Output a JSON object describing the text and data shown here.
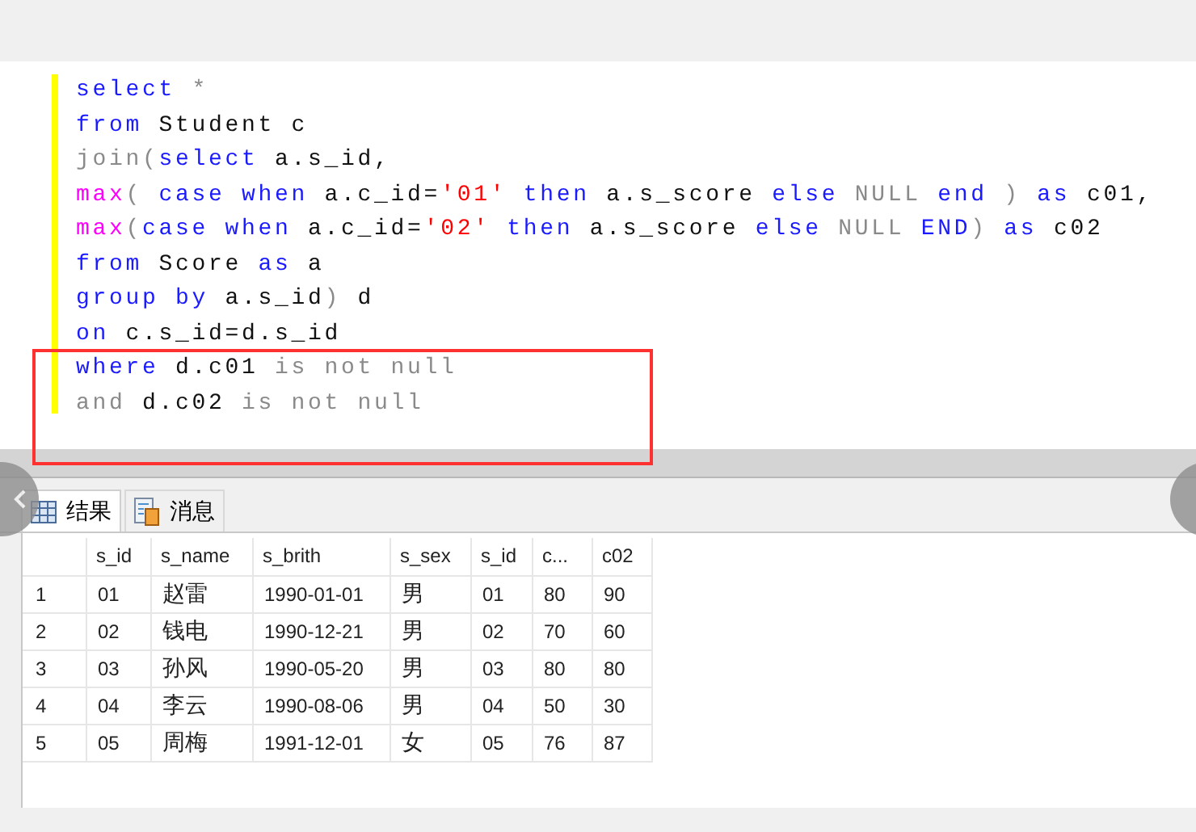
{
  "editor": {
    "lines": [
      [
        {
          "kind": "kw",
          "text": "select"
        },
        {
          "kind": "op",
          "text": " *"
        }
      ],
      [
        {
          "kind": "kw",
          "text": "from"
        },
        {
          "kind": "id",
          "text": " Student c"
        }
      ],
      [
        {
          "kind": "op",
          "text": "join("
        },
        {
          "kind": "kw",
          "text": "select"
        },
        {
          "kind": "id",
          "text": " a.s_id,"
        }
      ],
      [
        {
          "kind": "fn",
          "text": "max"
        },
        {
          "kind": "op",
          "text": "( "
        },
        {
          "kind": "kw",
          "text": "case when"
        },
        {
          "kind": "id",
          "text": " a.c_id="
        },
        {
          "kind": "str",
          "text": "'01'"
        },
        {
          "kind": "kw",
          "text": " then"
        },
        {
          "kind": "id",
          "text": " a.s_score "
        },
        {
          "kind": "kw",
          "text": "else"
        },
        {
          "kind": "op",
          "text": " NULL"
        },
        {
          "kind": "kw",
          "text": " end"
        },
        {
          "kind": "op",
          "text": " ) "
        },
        {
          "kind": "kw",
          "text": "as"
        },
        {
          "kind": "id",
          "text": " c01,"
        }
      ],
      [
        {
          "kind": "fn",
          "text": "max"
        },
        {
          "kind": "op",
          "text": "("
        },
        {
          "kind": "kw",
          "text": "case when"
        },
        {
          "kind": "id",
          "text": " a.c_id="
        },
        {
          "kind": "str",
          "text": "'02'"
        },
        {
          "kind": "kw",
          "text": " then"
        },
        {
          "kind": "id",
          "text": " a.s_score "
        },
        {
          "kind": "kw",
          "text": "else"
        },
        {
          "kind": "op",
          "text": " NULL"
        },
        {
          "kind": "kw",
          "text": " END"
        },
        {
          "kind": "op",
          "text": ")"
        },
        {
          "kind": "kw",
          "text": " as"
        },
        {
          "kind": "id",
          "text": " c02"
        }
      ],
      [
        {
          "kind": "kw",
          "text": "from"
        },
        {
          "kind": "id",
          "text": " Score "
        },
        {
          "kind": "kw",
          "text": "as"
        },
        {
          "kind": "id",
          "text": " a"
        }
      ],
      [
        {
          "kind": "kw",
          "text": "group by"
        },
        {
          "kind": "id",
          "text": " a.s_id"
        },
        {
          "kind": "op",
          "text": ")"
        },
        {
          "kind": "id",
          "text": " d"
        }
      ],
      [
        {
          "kind": "kw",
          "text": "on"
        },
        {
          "kind": "id",
          "text": " c.s_id=d.s_id"
        }
      ],
      [
        {
          "kind": "kw",
          "text": "where"
        },
        {
          "kind": "id",
          "text": " d.c01 "
        },
        {
          "kind": "op",
          "text": "is not null"
        }
      ],
      [
        {
          "kind": "op",
          "text": "and"
        },
        {
          "kind": "id",
          "text": " d.c02 "
        },
        {
          "kind": "op",
          "text": "is not null"
        }
      ]
    ]
  },
  "tabs": [
    {
      "label": "结果",
      "kind": "grid",
      "selected": true
    },
    {
      "label": "消息",
      "kind": "doc",
      "selected": false
    }
  ],
  "table": {
    "columns": [
      "s_id",
      "s_name",
      "s_brith",
      "s_sex",
      "s_id",
      "c...",
      "c02"
    ],
    "rows": [
      {
        "number": "1",
        "cells": [
          "01",
          "赵雷",
          "1990-01-01",
          "男",
          "01",
          "80",
          "90"
        ]
      },
      {
        "number": "2",
        "cells": [
          "02",
          "钱电",
          "1990-12-21",
          "男",
          "02",
          "70",
          "60"
        ]
      },
      {
        "number": "3",
        "cells": [
          "03",
          "孙风",
          "1990-05-20",
          "男",
          "03",
          "80",
          "80"
        ]
      },
      {
        "number": "4",
        "cells": [
          "04",
          "李云",
          "1990-08-06",
          "男",
          "04",
          "50",
          "30"
        ]
      },
      {
        "number": "5",
        "cells": [
          "05",
          "周梅",
          "1991-12-01",
          "女",
          "05",
          "76",
          "87"
        ]
      }
    ]
  }
}
